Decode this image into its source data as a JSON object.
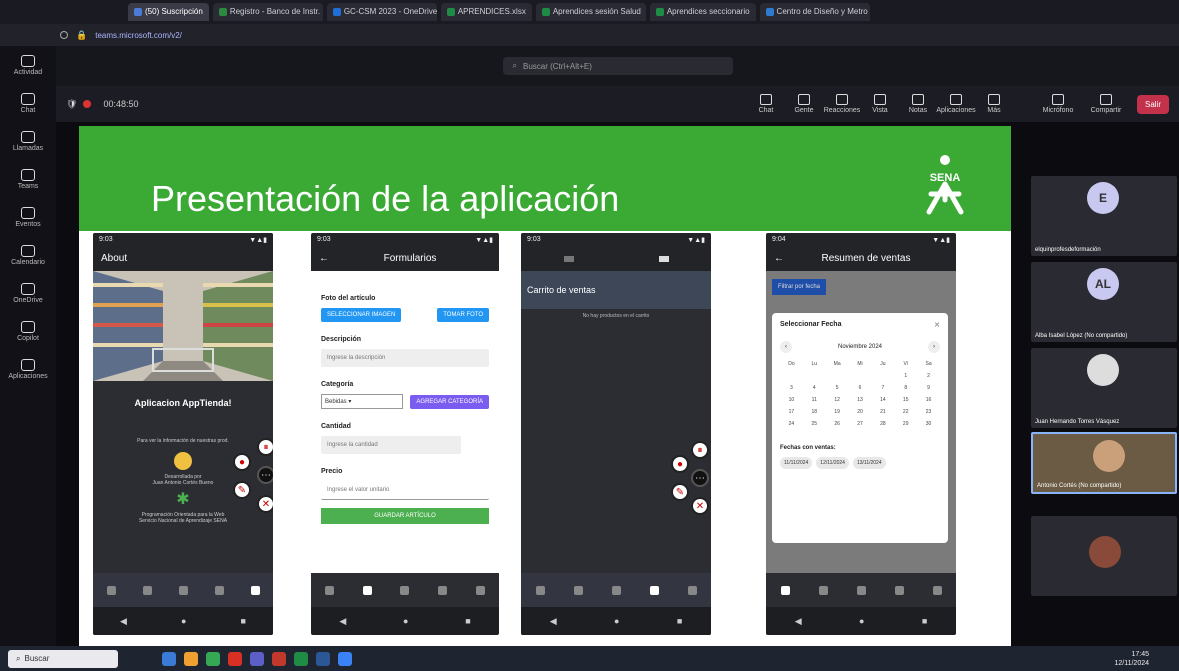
{
  "browser": {
    "tabs": [
      {
        "label": "(50) Suscripción",
        "color": "#4a7bd8",
        "active": true
      },
      {
        "label": "Registro - Banco de Instr.",
        "color": "#2b8a3e"
      },
      {
        "label": "GC-CSM 2023 - OneDrive",
        "color": "#1f6fd8"
      },
      {
        "label": "APRENDICES.xlsx",
        "color": "#1e8c45"
      },
      {
        "label": "Aprendices sesión Salud",
        "color": "#1e8c45"
      },
      {
        "label": "Aprendices seccionario",
        "color": "#1e8c45"
      },
      {
        "label": "Centro de Diseño y Metro",
        "color": "#2e7bd0"
      }
    ],
    "url": "teams.microsoft.com/v2/"
  },
  "teams": {
    "search_placeholder": "Buscar (Ctrl+Alt+E)",
    "appbar": [
      "Actividad",
      "Chat",
      "Llamadas",
      "Teams",
      "Eventos",
      "Calendario",
      "OneDrive",
      "Copilot",
      "Aplicaciones"
    ],
    "meeting_title": "00:48:50",
    "meeting_tools": [
      "Chat",
      "Gente",
      "Reacciones",
      "Vista",
      "Notas",
      "Aplicaciones",
      "Más"
    ],
    "right_tools": [
      "Micrófono",
      "Compartir"
    ],
    "leave_label": "Salir"
  },
  "slide": {
    "title": "Presentación de la aplicación",
    "logo_text": "SENA",
    "phone_about": {
      "status_left": "9:03",
      "header": "About",
      "app_title": "Aplicacion AppTienda!",
      "line1": "Para ver la información de nuestras prod.",
      "line2": "Desarrollada por",
      "line3": "Juan Antonio Cortés Bueno",
      "line4": "Programación Orientada para la Web",
      "line5": "Servicio Nacional de Aprendizaje SENA"
    },
    "phone_form": {
      "status_left": "9:03",
      "header": "Formularios",
      "label_foto": "Foto del artículo",
      "btn_select": "SELECCIONAR IMAGEN",
      "btn_photo": "TOMAR FOTO",
      "label_desc": "Descripción",
      "placeholder_desc": "Ingrese la descripción",
      "label_cat": "Categoría",
      "cat_value": "Bebidas",
      "btn_cat": "AGREGAR CATEGORÍA",
      "label_qty": "Cantidad",
      "placeholder_qty": "Ingrese la cantidad",
      "label_price": "Precio",
      "placeholder_price": "Ingrese el valor unitario",
      "btn_save": "GUARDAR ARTÍCULO"
    },
    "phone_cart": {
      "status_left": "9:03",
      "header": "Carrito de ventas",
      "empty_msg": "No hay productos en el carrito"
    },
    "phone_sales": {
      "status_left": "9:04",
      "header": "Resumen de ventas",
      "filter_btn": "Filtrar por fecha",
      "dialog_title": "Seleccionar Fecha",
      "month": "Noviembre 2024",
      "weekdays": [
        "Do",
        "Lu",
        "Ma",
        "Mi",
        "Ju",
        "Vi",
        "Sa"
      ],
      "days": [
        "",
        "",
        "",
        "",
        "",
        "1",
        "2",
        "3",
        "4",
        "5",
        "6",
        "7",
        "8",
        "9",
        "10",
        "11",
        "12",
        "13",
        "14",
        "15",
        "16",
        "17",
        "18",
        "19",
        "20",
        "21",
        "22",
        "23",
        "24",
        "25",
        "26",
        "27",
        "28",
        "29",
        "30"
      ],
      "range_label": "Fechas con ventas:",
      "chips": [
        "11/11/2024",
        "12/11/2024",
        "13/11/2024"
      ]
    }
  },
  "participants": [
    {
      "initial": "E",
      "name": "elquinprofesdeformación",
      "color": "#c9c8f0"
    },
    {
      "initial": "AL",
      "name": "Alba Isabel López (No compartido)",
      "color": "#c9c8f0"
    },
    {
      "initial": "",
      "name": "Juan Hernando Torres Vásquez",
      "color": "#dddddd"
    },
    {
      "initial": "",
      "name": "Antonio Cortés (No compartido)",
      "color": "#6b5a44"
    }
  ],
  "taskbar": {
    "search_label": "Buscar",
    "time": "17:45",
    "date": "12/11/2024"
  }
}
